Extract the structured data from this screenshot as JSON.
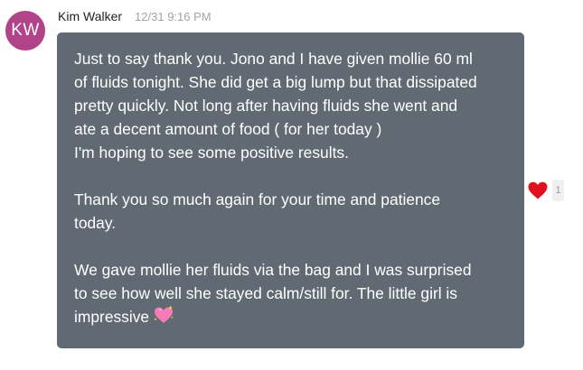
{
  "message": {
    "avatar_initials": "KW",
    "avatar_color": "#b0438a",
    "sender": "Kim Walker",
    "timestamp": "12/31 9:16 PM",
    "bubble_color": "#616a73",
    "paragraphs": [
      "Just to say thank you. Jono and I have given mollie 60 ml\nof fluids tonight. She did get a big lump but that dissipated\npretty quickly. Not long after having fluids she went and\nate a decent amount of food ( for her today )\nI'm hoping to see some positive results.",
      "Thank you so much again for your time and patience\ntoday.",
      "We gave mollie her fluids via the bag and I was surprised\nto see how well she stayed calm/still for. The little girl is\nimpressive"
    ],
    "trailing_emoji": "sparkling-heart-emoji",
    "reaction": {
      "icon": "heart-icon",
      "color": "#e0101f",
      "count": "1"
    }
  }
}
